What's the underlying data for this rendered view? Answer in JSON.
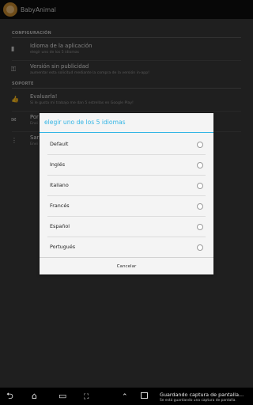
{
  "app": {
    "title": "BabyAnimal"
  },
  "settings": {
    "sections": [
      {
        "header": "CONFIGURACIÓN"
      },
      {
        "header": "SOPORTE"
      }
    ],
    "prefs": [
      {
        "title": "Idioma de la aplicación",
        "subtitle": "elegir uno de los 5 idiomas",
        "icon": "flag-icon"
      },
      {
        "title": "Versión sin publicidad",
        "subtitle": "aumentar esta solicitud mediante la compra de la versión in-app!",
        "icon": "key-icon"
      },
      {
        "title": "Evaluarla!",
        "subtitle": "Si le gusta mi trabajo me dan 5 estrellas en Google Play!",
        "icon": "thumbs-up-icon"
      },
      {
        "title": "Por",
        "subtitle": "Envi",
        "icon": "mail-icon"
      },
      {
        "title": "Sari",
        "subtitle": "Envi",
        "icon": "more-icon"
      }
    ]
  },
  "dialog": {
    "title": "elegir uno de los 5 idiomas",
    "options": [
      "Default",
      "Inglés",
      "Italiano",
      "Francés",
      "Español",
      "Portugués"
    ],
    "cancel": "Cancelar"
  },
  "systembar": {
    "notification_title": "Guardando captura de pantalla...",
    "notification_subtitle": "Se está guardando una captura de pantalla."
  }
}
